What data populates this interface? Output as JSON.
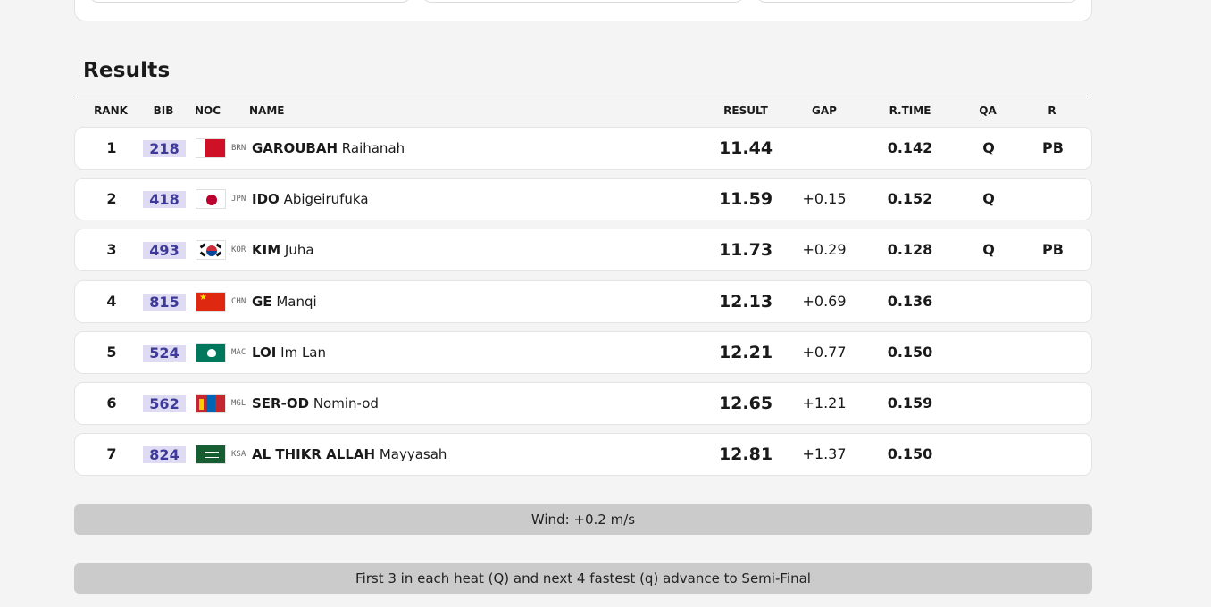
{
  "section_title": "Results",
  "columns": {
    "rank": "RANK",
    "bib": "BIB",
    "noc": "NOC",
    "name": "NAME",
    "result": "RESULT",
    "gap": "GAP",
    "rtime": "R.TIME",
    "qa": "QA",
    "rec": "R"
  },
  "rows": [
    {
      "rank": "1",
      "bib": "218",
      "noc": "BRN",
      "flag": "bahrain-flag-icon",
      "surname": "GAROUBAH",
      "given": "Raihanah",
      "result": "11.44",
      "gap": "",
      "rtime": "0.142",
      "qa": "Q",
      "rec": "PB"
    },
    {
      "rank": "2",
      "bib": "418",
      "noc": "JPN",
      "flag": "japan-flag-icon",
      "surname": "IDO",
      "given": "Abigeirufuka",
      "result": "11.59",
      "gap": "+0.15",
      "rtime": "0.152",
      "qa": "Q",
      "rec": ""
    },
    {
      "rank": "3",
      "bib": "493",
      "noc": "KOR",
      "flag": "korea-flag-icon",
      "surname": "KIM",
      "given": "Juha",
      "result": "11.73",
      "gap": "+0.29",
      "rtime": "0.128",
      "qa": "Q",
      "rec": "PB"
    },
    {
      "rank": "4",
      "bib": "815",
      "noc": "CHN",
      "flag": "china-flag-icon",
      "surname": "GE",
      "given": "Manqi",
      "result": "12.13",
      "gap": "+0.69",
      "rtime": "0.136",
      "qa": "",
      "rec": ""
    },
    {
      "rank": "5",
      "bib": "524",
      "noc": "MAC",
      "flag": "macau-flag-icon",
      "surname": "LOI",
      "given": "Im Lan",
      "result": "12.21",
      "gap": "+0.77",
      "rtime": "0.150",
      "qa": "",
      "rec": ""
    },
    {
      "rank": "6",
      "bib": "562",
      "noc": "MGL",
      "flag": "mongolia-flag-icon",
      "surname": "SER-OD",
      "given": "Nomin-od",
      "result": "12.65",
      "gap": "+1.21",
      "rtime": "0.159",
      "qa": "",
      "rec": ""
    },
    {
      "rank": "7",
      "bib": "824",
      "noc": "KSA",
      "flag": "saudi-arabia-flag-icon",
      "surname": "AL THIKR ALLAH",
      "given": "Mayyasah",
      "result": "12.81",
      "gap": "+1.37",
      "rtime": "0.150",
      "qa": "",
      "rec": ""
    }
  ],
  "wind_note": "Wind: +0.2 m/s",
  "qualification_note": "First 3 in each heat (Q) and next 4 fastest (q) advance to Semi-Final"
}
